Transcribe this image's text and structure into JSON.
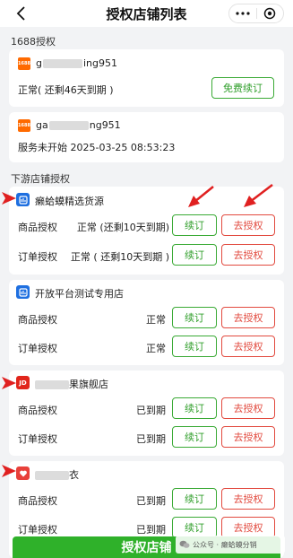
{
  "nav": {
    "title": "授权店铺列表",
    "back_icon": "chevron-left-icon",
    "more_icon": "more-dots-icon",
    "close_icon": "target-circle-icon"
  },
  "section_1688": {
    "title": "1688授权",
    "accounts": [
      {
        "logo_text": "1688",
        "account_prefix": "g",
        "account_suffix": "ing951",
        "status": "正常( 还剩46天到期 )",
        "button_label": "免费续订"
      },
      {
        "logo_text": "1688",
        "account_prefix": "ga",
        "account_suffix": "ng951",
        "status": "服务未开始  2025-03-25 08:53:23"
      }
    ]
  },
  "section_downstream": {
    "title": "下游店铺授权",
    "shops": [
      {
        "name": "癞蛤蟆精选货源",
        "logo": "store-app-icon",
        "rows": [
          {
            "label": "商品授权",
            "status": "正常 (还剩10天到期)",
            "renew": "续订",
            "revoke": "去授权"
          },
          {
            "label": "订单授权",
            "status": "正常 ( 还剩10天到期 )",
            "renew": "续订",
            "revoke": "去授权"
          }
        ]
      },
      {
        "name": "开放平台测试专用店",
        "logo": "store-app-icon",
        "rows": [
          {
            "label": "商品授权",
            "status": "正常",
            "renew": "续订",
            "revoke": "去授权"
          },
          {
            "label": "订单授权",
            "status": "正常",
            "renew": "续订",
            "revoke": "去授权"
          }
        ]
      },
      {
        "name_suffix": "果旗舰店",
        "logo_text": "JD",
        "rows": [
          {
            "label": "商品授权",
            "status": "已到期",
            "renew": "续订",
            "revoke": "去授权"
          },
          {
            "label": "订单授权",
            "status": "已到期",
            "renew": "续订",
            "revoke": "去授权"
          }
        ]
      },
      {
        "name_suffix": "衣",
        "logo": "red-heart-store-icon",
        "rows": [
          {
            "label": "商品授权",
            "status": "已到期",
            "renew": "续订",
            "revoke": "去授权"
          },
          {
            "label": "订单授权",
            "status": "已到期",
            "renew": "续订",
            "revoke": "去授权"
          }
        ]
      }
    ]
  },
  "bottom": {
    "button_label": "授权店铺",
    "watermark_text": "公众号 · 癞蛤蟆分销"
  },
  "colors": {
    "green": "#2f9e2a",
    "red": "#e24a3f",
    "brand_1688": "#ff6a00",
    "jd_red": "#e1251b",
    "app_blue": "#1e6fe0"
  }
}
